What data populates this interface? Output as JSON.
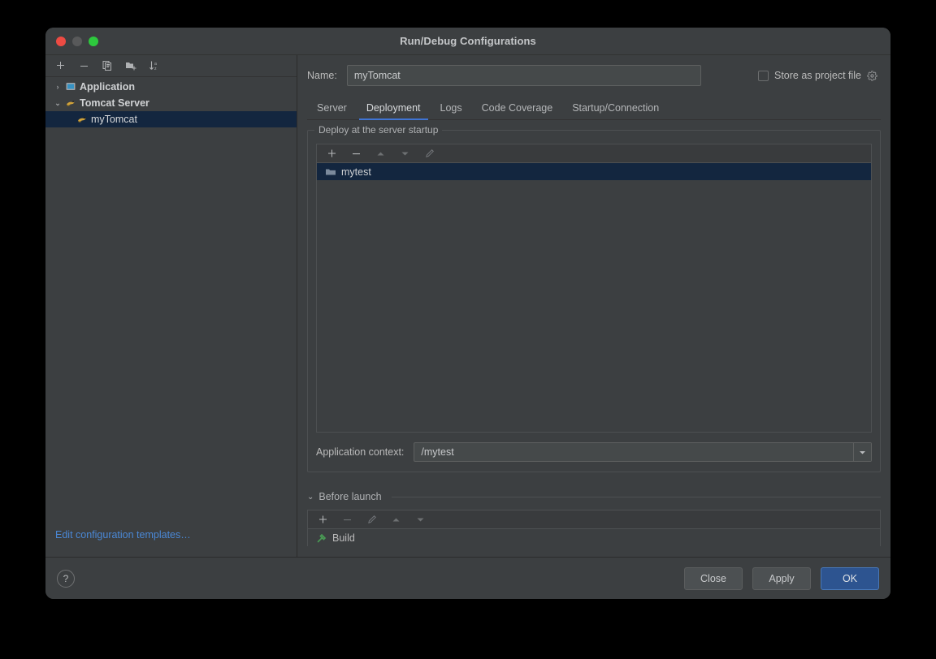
{
  "window": {
    "title": "Run/Debug Configurations",
    "traffic_lights": [
      "close",
      "minimize",
      "zoom"
    ]
  },
  "sidebar": {
    "toolbar": [
      {
        "name": "add-configuration-button",
        "icon": "plus-icon",
        "label": "Add New Configuration"
      },
      {
        "name": "remove-configuration-button",
        "icon": "minus-icon",
        "label": "Remove Configuration"
      },
      {
        "name": "copy-configuration-button",
        "icon": "copy-icon",
        "label": "Copy Configuration"
      },
      {
        "name": "move-into-folder-button",
        "icon": "folder-add-icon",
        "label": "Create New Folder"
      },
      {
        "name": "sort-configurations-button",
        "icon": "sort-alpha-icon",
        "label": "Sort Configurations"
      }
    ],
    "tree": [
      {
        "label": "Application",
        "icon": "application-icon",
        "expanded": false,
        "arrow": "›",
        "level": 0,
        "selected": false
      },
      {
        "label": "Tomcat Server",
        "icon": "tomcat-icon",
        "expanded": true,
        "arrow": "⌄",
        "level": 0,
        "selected": false
      },
      {
        "label": "myTomcat",
        "icon": "tomcat-icon",
        "level": 1,
        "selected": true
      }
    ],
    "footer_link": "Edit configuration templates…"
  },
  "main": {
    "name_label": "Name:",
    "name_value": "myTomcat",
    "name_placeholder": "",
    "store_as_project_file": {
      "label": "Store as project file",
      "checked": false,
      "gear_icon": "gear-icon"
    },
    "tabs": [
      {
        "label": "Server",
        "active": false
      },
      {
        "label": "Deployment",
        "active": true
      },
      {
        "label": "Logs",
        "active": false
      },
      {
        "label": "Code Coverage",
        "active": false
      },
      {
        "label": "Startup/Connection",
        "active": false
      }
    ],
    "deploy_panel": {
      "legend": "Deploy at the server startup",
      "toolbar": [
        {
          "name": "add-artifact-button",
          "icon": "plus-icon",
          "enabled": true
        },
        {
          "name": "remove-artifact-button",
          "icon": "minus-icon",
          "enabled": true
        },
        {
          "name": "move-up-button",
          "icon": "arrow-up-icon",
          "enabled": false
        },
        {
          "name": "move-down-button",
          "icon": "arrow-down-icon",
          "enabled": false
        },
        {
          "name": "edit-artifact-button",
          "icon": "pencil-icon",
          "enabled": false
        }
      ],
      "items": [
        {
          "label": "mytest",
          "icon": "folder-icon",
          "selected": true
        }
      ],
      "application_context_label": "Application context:",
      "application_context_value": "/mytest"
    },
    "before_launch": {
      "title": "Before launch",
      "collapse_arrow": "⌄",
      "toolbar": [
        {
          "name": "add-task-button",
          "icon": "plus-icon",
          "enabled": true
        },
        {
          "name": "remove-task-button",
          "icon": "minus-icon",
          "enabled": false
        },
        {
          "name": "edit-task-button",
          "icon": "pencil-icon",
          "enabled": false
        },
        {
          "name": "task-move-up-button",
          "icon": "arrow-up-icon",
          "enabled": false
        },
        {
          "name": "task-move-down-button",
          "icon": "arrow-down-icon",
          "enabled": false
        }
      ],
      "tasks": [
        {
          "label": "Build",
          "icon": "build-hammer-icon"
        }
      ]
    }
  },
  "footer": {
    "help_label": "?",
    "close_label": "Close",
    "apply_label": "Apply",
    "ok_label": "OK"
  },
  "colors": {
    "window_bg": "#3c3f41",
    "selection_blue": "#13263f",
    "accent_blue": "#3f74d3",
    "link_blue": "#4a88d6",
    "ok_button_blue": "#2d5490",
    "text_primary": "#bbbbbb",
    "build_icon_green": "#499c54",
    "tomcat_icon_yellow": "#d2a33a"
  }
}
